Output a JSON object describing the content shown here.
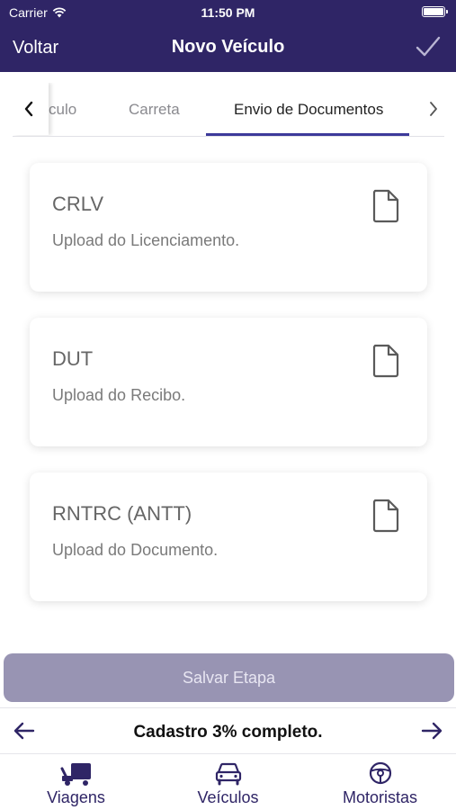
{
  "status_bar": {
    "carrier": "Carrier",
    "time": "11:50 PM"
  },
  "nav": {
    "back_label": "Voltar",
    "title": "Novo Veículo",
    "confirm_icon": "checkmark-icon"
  },
  "tabs": {
    "items": [
      {
        "label": "culo",
        "active": false
      },
      {
        "label": "Carreta",
        "active": false
      },
      {
        "label": "Envio de Documentos",
        "active": true
      }
    ],
    "left_icon": "chevron-left-icon",
    "right_icon": "chevron-right-icon"
  },
  "cards": [
    {
      "title": "CRLV",
      "subtitle": "Upload do Licenciamento.",
      "icon": "document-icon"
    },
    {
      "title": "DUT",
      "subtitle": "Upload do Recibo.",
      "icon": "document-icon"
    },
    {
      "title": "RNTRC (ANTT)",
      "subtitle": "Upload do Documento.",
      "icon": "document-icon"
    }
  ],
  "save_button": {
    "label": "Salvar Etapa"
  },
  "progress": {
    "text": "Cadastro 3% completo.",
    "percent": 3
  },
  "tab_bar": {
    "items": [
      {
        "label": "Viagens",
        "icon": "truck-icon"
      },
      {
        "label": "Veículos",
        "icon": "car-icon"
      },
      {
        "label": "Motoristas",
        "icon": "steering-wheel-icon"
      }
    ]
  },
  "colors": {
    "primary": "#2f2566",
    "button_disabled": "#9894b3",
    "tab_indicator": "#3d3a9a"
  }
}
